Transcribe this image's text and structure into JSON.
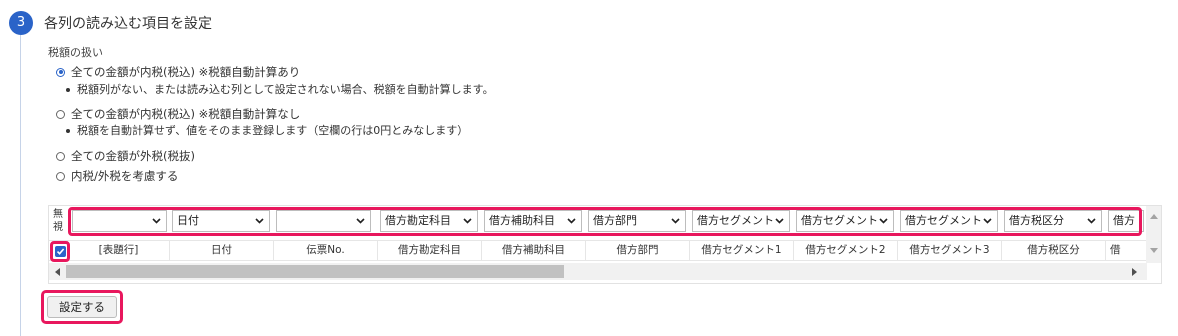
{
  "step": {
    "number": "3",
    "title": "各列の読み込む項目を設定"
  },
  "tax": {
    "label": "税額の扱い",
    "options": [
      {
        "label": "全ての金額が内税(税込) ※税額自動計算あり",
        "checked": true,
        "note": "税額列がない、または読み込む列として設定されない場合、税額を自動計算します。"
      },
      {
        "label": "全ての金額が内税(税込) ※税額自動計算なし",
        "checked": false,
        "note": "税額を自動計算せず、値をそのまま登録します（空欄の行は0円とみなします）"
      },
      {
        "label": "全ての金額が外税(税抜)",
        "checked": false
      },
      {
        "label": "内税/外税を考慮する",
        "checked": false
      }
    ]
  },
  "grid": {
    "ignore_label": "無視",
    "selects": [
      "",
      "日付",
      "",
      "借方勘定科目",
      "借方補助科目",
      "借方部門",
      "借方セグメント",
      "借方セグメント",
      "借方セグメント",
      "借方税区分",
      "借方"
    ],
    "row": [
      "[表題行]",
      "日付",
      "伝票No.",
      "借方勘定科目",
      "借方補助科目",
      "借方部門",
      "借方セグメント1",
      "借方セグメント2",
      "借方セグメント3",
      "借方税区分",
      "借"
    ],
    "row_checked": true
  },
  "actions": {
    "set_label": "設定する"
  },
  "colors": {
    "accent": "#2a63c8",
    "highlight": "#e8175d"
  }
}
